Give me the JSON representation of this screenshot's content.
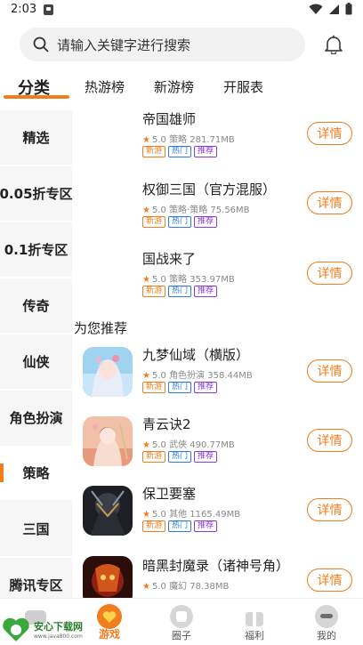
{
  "status_bar": {
    "time": "2:03"
  },
  "search": {
    "placeholder": "请输入关键字进行搜索"
  },
  "tabs": [
    {
      "label": "分类",
      "active": true
    },
    {
      "label": "热游榜",
      "active": false
    },
    {
      "label": "新游榜",
      "active": false
    },
    {
      "label": "开服表",
      "active": false
    }
  ],
  "sidebar": {
    "items": [
      {
        "label": "精选"
      },
      {
        "label": "0.05折专区"
      },
      {
        "label": "0.1折专区"
      },
      {
        "label": "传奇"
      },
      {
        "label": "仙侠"
      },
      {
        "label": "角色扮演"
      },
      {
        "label": "策略",
        "active": true
      },
      {
        "label": "三国"
      },
      {
        "label": "腾讯专区"
      }
    ]
  },
  "top_games": [
    {
      "name": "帝国雄师",
      "score": "5.0",
      "info": "策略 281.71MB",
      "tags": [
        "新游",
        "热门",
        "推荐"
      ],
      "action": "详情"
    },
    {
      "name": "权御三国（官方混服）",
      "score": "5.0",
      "info": "策略·策略 75.56MB",
      "tags": [
        "新游",
        "热门",
        "推荐"
      ],
      "action": "详情"
    },
    {
      "name": "国战来了",
      "score": "5.0",
      "info": "策略 353.97MB",
      "tags": [
        "新游",
        "热门",
        "推荐"
      ],
      "action": "详情"
    }
  ],
  "recommend": {
    "title": "为您推荐",
    "games": [
      {
        "name": "九梦仙域（横版）",
        "score": "5.0",
        "info": "角色扮演 358.44MB",
        "tags": [
          "新游",
          "热门",
          "推荐"
        ],
        "action": "详情",
        "icon": "fairy-girl-icon"
      },
      {
        "name": "青云诀2",
        "score": "5.0",
        "info": "武侠 490.77MB",
        "tags": [
          "新游",
          "热门",
          "推荐"
        ],
        "action": "详情",
        "icon": "swordswoman-icon"
      },
      {
        "name": "保卫要塞",
        "score": "5.0",
        "info": "其他 1165.49MB",
        "tags": [
          "新游",
          "热门",
          "推荐"
        ],
        "action": "详情",
        "icon": "warrior-icon"
      },
      {
        "name": "暗黑封魔录（诸神号角）",
        "score": "5.0",
        "info": "魔幻 78.38MB",
        "tags": [],
        "action": "详情",
        "icon": "demon-icon"
      }
    ]
  },
  "bottom_nav": [
    {
      "label": "",
      "icon": "home-icon"
    },
    {
      "label": "游戏",
      "icon": "game-heart-icon",
      "active": true
    },
    {
      "label": "圈子",
      "icon": "circle-icon"
    },
    {
      "label": "福利",
      "icon": "gift-icon"
    },
    {
      "label": "我的",
      "icon": "profile-icon"
    }
  ],
  "watermark": {
    "brand": "安心下载网",
    "url": "www.java800.com"
  },
  "colors": {
    "accent": "#f07d1e",
    "tag_blue": "#2e7be0",
    "tag_purple": "#8a3bd6"
  }
}
